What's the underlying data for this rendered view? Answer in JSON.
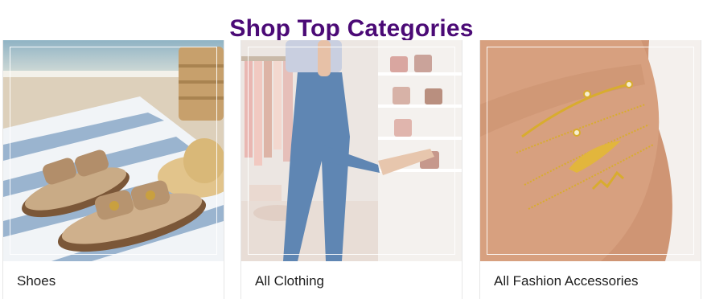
{
  "section": {
    "title": "Shop Top Categories"
  },
  "categories": [
    {
      "label": "Shoes",
      "image": "sandals-on-beach-towel"
    },
    {
      "label": "All Clothing",
      "image": "model-in-jeans-boutique"
    },
    {
      "label": "All Fashion Accessories",
      "image": "gold-bracelets-on-wrist"
    }
  ],
  "colors": {
    "title": "#4b0a76",
    "label": "#1e1e1e"
  }
}
